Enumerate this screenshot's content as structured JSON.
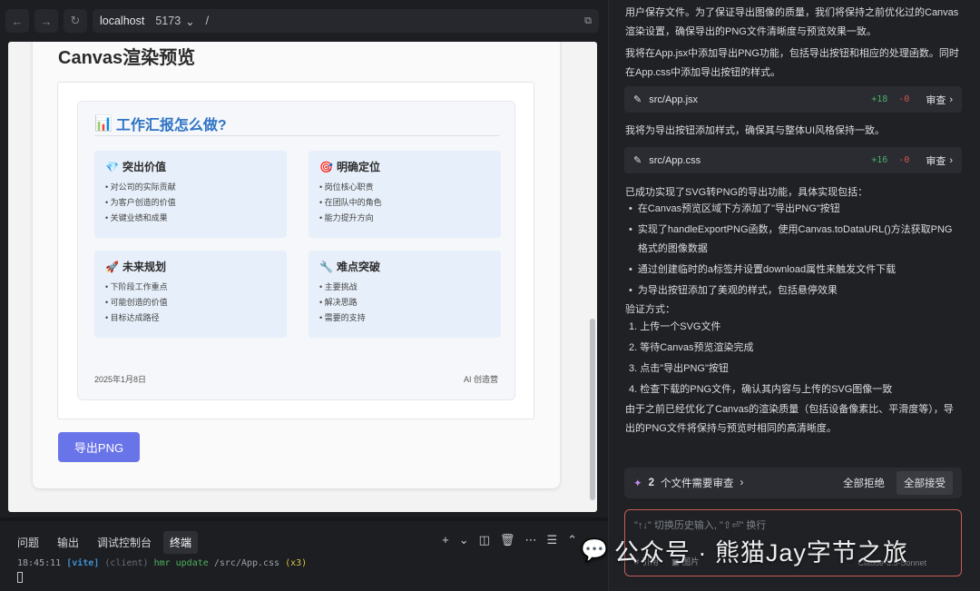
{
  "browser": {
    "host": "localhost",
    "port": "5173",
    "path": "/"
  },
  "preview": {
    "title": "Canvas渲染预览",
    "report_title": "工作汇报怎么做?",
    "report_icon": "📊",
    "sections": [
      {
        "icon": "💎",
        "title": "突出价值",
        "items": [
          "• 对公司的实际贡献",
          "• 为客户创造的价值",
          "• 关键业绩和成果"
        ]
      },
      {
        "icon": "🎯",
        "title": "明确定位",
        "items": [
          "• 岗位核心职责",
          "• 在团队中的角色",
          "• 能力提升方向"
        ]
      },
      {
        "icon": "🚀",
        "title": "未来规划",
        "items": [
          "• 下阶段工作重点",
          "• 可能创造的价值",
          "• 目标达成路径"
        ]
      },
      {
        "icon": "🔧",
        "title": "难点突破",
        "items": [
          "• 主要挑战",
          "• 解决思路",
          "• 需要的支持"
        ]
      }
    ],
    "footer_date": "2025年1月8日",
    "footer_brand": "AI 创造营",
    "export_button": "导出PNG"
  },
  "terminal": {
    "tabs": [
      "问题",
      "输出",
      "调试控制台",
      "终端"
    ],
    "active_tab": "终端",
    "log_time": "18:45:11",
    "log_tag": "[vite]",
    "log_client": "(client)",
    "log_msg": "hmr update",
    "log_path": "/src/App.css",
    "log_count": "(x3)"
  },
  "chat": {
    "para1": "用户保存文件。为了保证导出图像的质量，我们将保持之前优化过的Canvas渲染设置，确保导出的PNG文件清晰度与预览效果一致。",
    "para2": "我将在App.jsx中添加导出PNG功能，包括导出按钮和相应的处理函数。同时在App.css中添加导出按钮的样式。",
    "file1": {
      "name": "src/App.jsx",
      "adds": "+18",
      "dels": "-0",
      "review": "审查"
    },
    "para3": "我将为导出按钮添加样式，确保其与整体UI风格保持一致。",
    "file2": {
      "name": "src/App.css",
      "adds": "+16",
      "dels": "-0",
      "review": "审查"
    },
    "para4": "已成功实现了SVG转PNG的导出功能，具体实现包括：",
    "bullets": [
      "在Canvas预览区域下方添加了\"导出PNG\"按钮",
      "实现了handleExportPNG函数，使用Canvas.toDataURL()方法获取PNG格式的图像数据",
      "通过创建临时的a标签并设置download属性来触发文件下载",
      "为导出按钮添加了美观的样式，包括悬停效果"
    ],
    "verify_label": "验证方式：",
    "steps": [
      "1. 上传一个SVG文件",
      "2. 等待Canvas预览渲染完成",
      "3. 点击\"导出PNG\"按钮",
      "4. 检查下载的PNG文件，确认其内容与上传的SVG图像一致"
    ],
    "para5": "由于之前已经优化了Canvas的渲染质量（包括设备像素比、平滑度等），导出的PNG文件将保持与预览时相同的高清晰度。",
    "review_count": "2",
    "review_text": "个文件需要审查",
    "reject_all": "全部拒绝",
    "accept_all": "全部接受",
    "input_placeholder": "\"↑↓\" 切换历史输入, \"⇧⏎\" 换行",
    "input_ref": "# 引用",
    "input_image": "图片",
    "model": "Claude-3.5-Sonnet"
  },
  "watermark": "公众号 · 熊猫Jay字节之旅"
}
